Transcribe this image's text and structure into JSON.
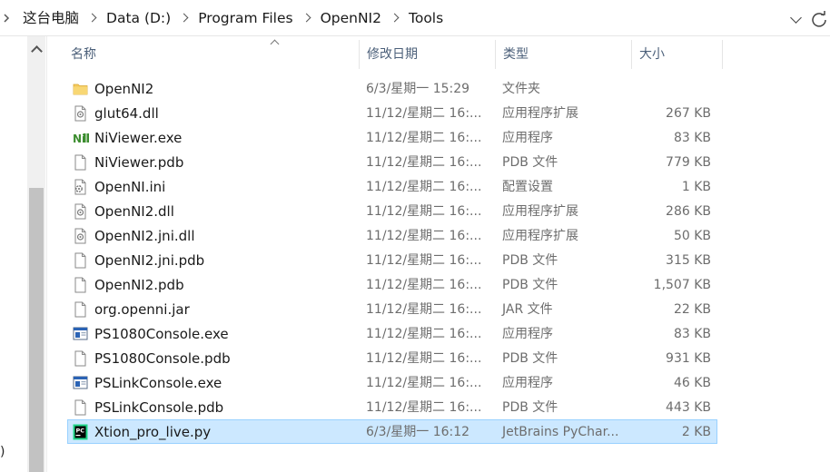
{
  "breadcrumb": {
    "items": [
      "这台电脑",
      "Data (D:)",
      "Program Files",
      "OpenNI2",
      "Tools"
    ]
  },
  "columns": {
    "name": "名称",
    "date": "修改日期",
    "type": "类型",
    "size": "大小"
  },
  "files": [
    {
      "name": "OpenNI2",
      "date": "6/3/星期一 15:29",
      "type": "文件夹",
      "size": "",
      "icon": "folder-icon",
      "selected": false
    },
    {
      "name": "glut64.dll",
      "date": "11/12/星期二 16:...",
      "type": "应用程序扩展",
      "size": "267 KB",
      "icon": "dll-file-icon",
      "selected": false
    },
    {
      "name": "NiViewer.exe",
      "date": "11/12/星期二 16:...",
      "type": "应用程序",
      "size": "83 KB",
      "icon": "niviewer-app-icon",
      "selected": false
    },
    {
      "name": "NiViewer.pdb",
      "date": "11/12/星期二 16:...",
      "type": "PDB 文件",
      "size": "779 KB",
      "icon": "blank-file-icon",
      "selected": false
    },
    {
      "name": "OpenNI.ini",
      "date": "11/12/星期二 16:...",
      "type": "配置设置",
      "size": "1 KB",
      "icon": "ini-file-icon",
      "selected": false
    },
    {
      "name": "OpenNI2.dll",
      "date": "11/12/星期二 16:...",
      "type": "应用程序扩展",
      "size": "286 KB",
      "icon": "dll-file-icon",
      "selected": false
    },
    {
      "name": "OpenNI2.jni.dll",
      "date": "11/12/星期二 16:...",
      "type": "应用程序扩展",
      "size": "50 KB",
      "icon": "dll-file-icon",
      "selected": false
    },
    {
      "name": "OpenNI2.jni.pdb",
      "date": "11/12/星期二 16:...",
      "type": "PDB 文件",
      "size": "315 KB",
      "icon": "blank-file-icon",
      "selected": false
    },
    {
      "name": "OpenNI2.pdb",
      "date": "11/12/星期二 16:...",
      "type": "PDB 文件",
      "size": "1,507 KB",
      "icon": "blank-file-icon",
      "selected": false
    },
    {
      "name": "org.openni.jar",
      "date": "11/12/星期二 16:...",
      "type": "JAR 文件",
      "size": "22 KB",
      "icon": "blank-file-icon",
      "selected": false
    },
    {
      "name": "PS1080Console.exe",
      "date": "11/12/星期二 16:...",
      "type": "应用程序",
      "size": "83 KB",
      "icon": "console-app-icon",
      "selected": false
    },
    {
      "name": "PS1080Console.pdb",
      "date": "11/12/星期二 16:...",
      "type": "PDB 文件",
      "size": "931 KB",
      "icon": "blank-file-icon",
      "selected": false
    },
    {
      "name": "PSLinkConsole.exe",
      "date": "11/12/星期二 16:...",
      "type": "应用程序",
      "size": "46 KB",
      "icon": "console-app-icon",
      "selected": false
    },
    {
      "name": "PSLinkConsole.pdb",
      "date": "11/12/星期二 16:...",
      "type": "PDB 文件",
      "size": "443 KB",
      "icon": "blank-file-icon",
      "selected": false
    },
    {
      "name": "Xtion_pro_live.py",
      "date": "6/3/星期一 16:12",
      "type": "JetBrains PyChar...",
      "size": "2 KB",
      "icon": "pycharm-file-icon",
      "selected": true
    }
  ],
  "nav_partial_text": ")",
  "colors": {
    "selection_bg": "#cce8ff",
    "selection_border": "#99d1ff",
    "header_text": "#4c607a",
    "folder": "#f4c95d"
  }
}
